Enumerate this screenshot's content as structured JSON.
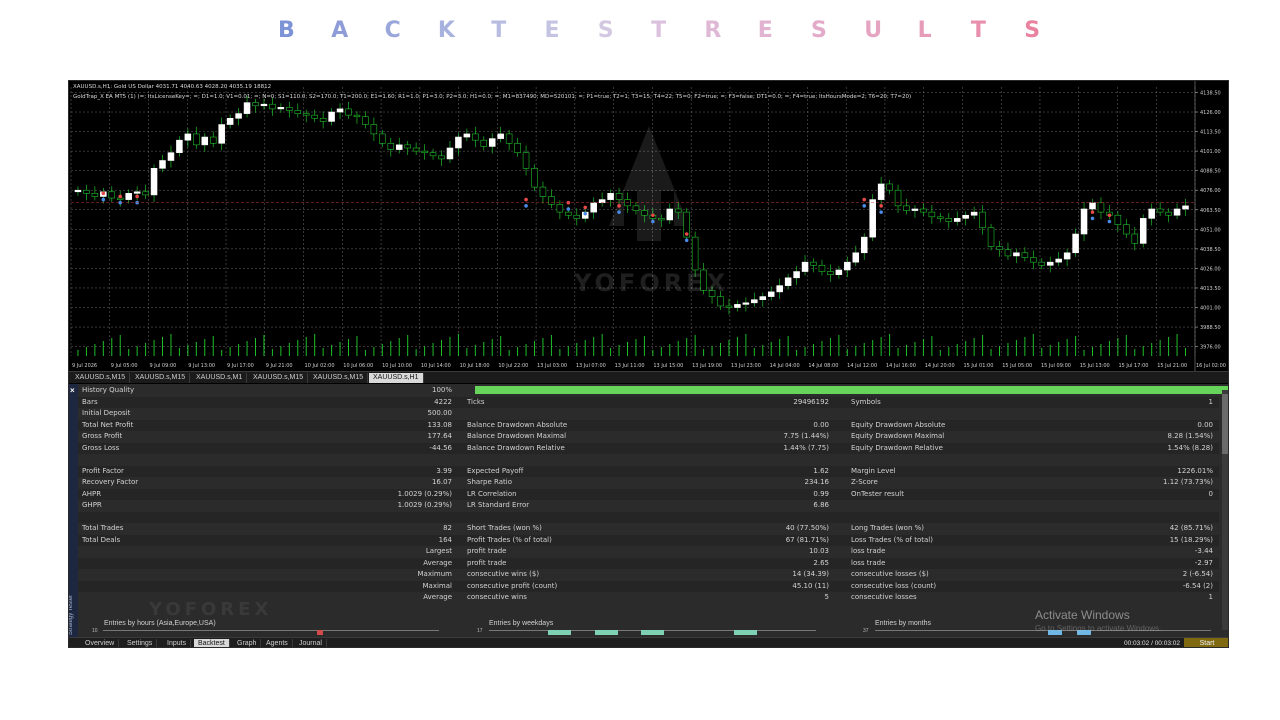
{
  "banner": {
    "letters": [
      "B",
      "A",
      "C",
      "K",
      "T",
      "E",
      "S",
      "T",
      "R",
      "E",
      "S",
      "U",
      "L",
      "T",
      "S"
    ],
    "colors": [
      "#7c93d6",
      "#8e9cd8",
      "#9aa7db",
      "#a8b2de",
      "#b7bce0",
      "#c4c3e2",
      "#d3c8e2",
      "#dbc1dd",
      "#dfb8d6",
      "#e2b2d1",
      "#e3aac9",
      "#e5a4c2",
      "#e69bb9",
      "#e88fae",
      "#e8829f"
    ]
  },
  "chart": {
    "header_line1": "XAUUSD.s,H1:  Gold US Dollar  4031.71 4040.63 4028.20 4035.19  18812",
    "header_line2": "GoldTrap_X EA MT5 (1) (=; ItsLicenseKey=; =; D1=1.0; V1=0.01; =; N=0; S1=110.0; S2=170.0; T1=200.0; E1=1.60; R1=1.0; P1=3.0; P2=3.0; H1=0.0; =; M1=837490; MD=520101; =; P1=true; T2=1; T3=15; T4=22; T5=0; F2=true; =; F3=false; DT1=0.0; =; F4=true; ItsHoursMode=2; T6=20; T7=20)",
    "price_labels": [
      "4138.50",
      "4126.00",
      "4113.50",
      "4101.00",
      "4088.50",
      "4076.00",
      "4063.50",
      "4051.00",
      "4038.50",
      "4026.00",
      "4013.50",
      "4001.00",
      "3988.50",
      "3976.00"
    ],
    "time_labels": [
      "9 Jul 2026",
      "9 Jul 05:00",
      "9 Jul 09:00",
      "9 Jul 13:00",
      "9 Jul 17:00",
      "9 Jul 21:00",
      "10 Jul 02:00",
      "10 Jul 06:00",
      "10 Jul 10:00",
      "10 Jul 14:00",
      "10 Jul 18:00",
      "10 Jul 22:00",
      "13 Jul 03:00",
      "13 Jul 07:00",
      "13 Jul 11:00",
      "13 Jul 15:00",
      "13 Jul 19:00",
      "13 Jul 23:00",
      "14 Jul 04:00",
      "14 Jul 08:00",
      "14 Jul 12:00",
      "14 Jul 16:00",
      "14 Jul 20:00",
      "15 Jul 01:00",
      "15 Jul 05:00",
      "15 Jul 09:00",
      "15 Jul 13:00",
      "15 Jul 17:00",
      "15 Jul 21:00",
      "16 Jul 02:00"
    ],
    "watermark": "YOFOREX",
    "price_range": [
      3970,
      4142
    ],
    "closes": [
      4076,
      4074,
      4072,
      4075,
      4071,
      4070,
      4074,
      4075,
      4073,
      4090,
      4095,
      4100,
      4108,
      4112,
      4105,
      4110,
      4106,
      4118,
      4122,
      4125,
      4132,
      4130,
      4131,
      4128,
      4129,
      4127,
      4125,
      4124,
      4122,
      4120,
      4126,
      4128,
      4124,
      4123,
      4118,
      4112,
      4106,
      4102,
      4105,
      4103,
      4101,
      4100,
      4098,
      4096,
      4103,
      4110,
      4112,
      4108,
      4104,
      4109,
      4112,
      4106,
      4100,
      4090,
      4078,
      4072,
      4067,
      4062,
      4060,
      4058,
      4062,
      4068,
      4070,
      4074,
      4070,
      4066,
      4063,
      4060,
      4058,
      4057,
      4064,
      4062,
      4046,
      4025,
      4012,
      4008,
      4002,
      4001,
      4003,
      4004,
      4006,
      4008,
      4011,
      4015,
      4020,
      4024,
      4030,
      4028,
      4024,
      4022,
      4025,
      4030,
      4036,
      4046,
      4070,
      4080,
      4076,
      4066,
      4063,
      4064,
      4062,
      4059,
      4058,
      4056,
      4058,
      4060,
      4062,
      4052,
      4040,
      4038,
      4034,
      4036,
      4033,
      4030,
      4028,
      4030,
      4032,
      4036,
      4048,
      4064,
      4068,
      4062,
      4060,
      4054,
      4048,
      4042,
      4058,
      4064,
      4062,
      4060,
      4064,
      4066
    ]
  },
  "symbol_tabs": [
    "XAUUSD.s,M15",
    "XAUUSD.s,M15",
    "XAUUSD.s,M1",
    "XAUUSD.s,M15",
    "XAUUSD.s,M15",
    "XAUUSD.s,H1"
  ],
  "tester": {
    "sidebar_x": "×",
    "sidebar_title": "Strategy Tester",
    "rows": [
      {
        "c1l": "History Quality",
        "c1v": "100%",
        "c2l": "",
        "c2v": "",
        "c3l": "",
        "c3v": "",
        "bar": true
      },
      {
        "c1l": "Bars",
        "c1v": "4222",
        "c2l": "Ticks",
        "c2v": "29496192",
        "c3l": "Symbols",
        "c3v": "1"
      },
      {
        "c1l": "Initial Deposit",
        "c1v": "500.00",
        "c2l": "",
        "c2v": "",
        "c3l": "",
        "c3v": ""
      },
      {
        "c1l": "Total Net Profit",
        "c1v": "133.08",
        "c2l": "Balance Drawdown Absolute",
        "c2v": "0.00",
        "c3l": "Equity Drawdown Absolute",
        "c3v": "0.00"
      },
      {
        "c1l": "Gross Profit",
        "c1v": "177.64",
        "c2l": "Balance Drawdown Maximal",
        "c2v": "7.75 (1.44%)",
        "c3l": "Equity Drawdown Maximal",
        "c3v": "8.28 (1.54%)"
      },
      {
        "c1l": "Gross Loss",
        "c1v": "-44.56",
        "c2l": "Balance Drawdown Relative",
        "c2v": "1.44% (7.75)",
        "c3l": "Equity Drawdown Relative",
        "c3v": "1.54% (8.28)"
      },
      {
        "c1l": "",
        "c1v": "",
        "c2l": "",
        "c2v": "",
        "c3l": "",
        "c3v": ""
      },
      {
        "c1l": "Profit Factor",
        "c1v": "3.99",
        "c2l": "Expected Payoff",
        "c2v": "1.62",
        "c3l": "Margin Level",
        "c3v": "1226.01%"
      },
      {
        "c1l": "Recovery Factor",
        "c1v": "16.07",
        "c2l": "Sharpe Ratio",
        "c2v": "234.16",
        "c3l": "Z-Score",
        "c3v": "1.12 (73.73%)"
      },
      {
        "c1l": "AHPR",
        "c1v": "1.0029 (0.29%)",
        "c2l": "LR Correlation",
        "c2v": "0.99",
        "c3l": "OnTester result",
        "c3v": "0"
      },
      {
        "c1l": "GHPR",
        "c1v": "1.0029 (0.29%)",
        "c2l": "LR Standard Error",
        "c2v": "6.86",
        "c3l": "",
        "c3v": ""
      },
      {
        "c1l": "",
        "c1v": "",
        "c2l": "",
        "c2v": "",
        "c3l": "",
        "c3v": ""
      },
      {
        "c1l": "Total Trades",
        "c1v": "82",
        "c2l": "Short Trades (won %)",
        "c2v": "40 (77.50%)",
        "c3l": "Long Trades (won %)",
        "c3v": "42 (85.71%)"
      },
      {
        "c1l": "Total Deals",
        "c1v": "164",
        "c2l": "Profit Trades (% of total)",
        "c2v": "67 (81.71%)",
        "c3l": "Loss Trades (% of total)",
        "c3v": "15 (18.29%)"
      },
      {
        "c1l": "",
        "c1v": "Largest",
        "c2l": "profit trade",
        "c2v": "10.03",
        "c3l": "loss trade",
        "c3v": "-3.44"
      },
      {
        "c1l": "",
        "c1v": "Average",
        "c2l": "profit trade",
        "c2v": "2.65",
        "c3l": "loss trade",
        "c3v": "-2.97"
      },
      {
        "c1l": "",
        "c1v": "Maximum",
        "c2l": "consecutive wins ($)",
        "c2v": "14 (34.39)",
        "c3l": "consecutive losses ($)",
        "c3v": "2 (-6.54)"
      },
      {
        "c1l": "",
        "c1v": "Maximal",
        "c2l": "consecutive profit (count)",
        "c2v": "45.10 (11)",
        "c3l": "consecutive loss (count)",
        "c3v": "-6.54 (2)"
      },
      {
        "c1l": "",
        "c1v": "Average",
        "c2l": "consecutive wins",
        "c2v": "5",
        "c3l": "consecutive losses",
        "c3v": "1"
      }
    ],
    "dist": {
      "hours_title": "Entries by hours (Asia,Europe,USA)",
      "hours_num": "10",
      "weekdays_title": "Entries by weekdays",
      "weekdays_num": "17",
      "months_title": "Entries by months",
      "months_num": "37"
    },
    "activate_title": "Activate Windows",
    "activate_sub": "Go to Settings to activate Windows.",
    "bottom_tabs": [
      "Overview",
      "Settings",
      "Inputs",
      "Backtest",
      "Graph",
      "Agents",
      "Journal"
    ],
    "active_bottom_tab": "Backtest",
    "timer": "00:03:02 / 00:03:02",
    "start_label": "Start"
  },
  "colors": {
    "bull": "#ffffff",
    "bear": "#1fbf2a",
    "grid": "#6e6e6e",
    "quality_bar": "#66d45a",
    "start_button": "#7f6a12"
  }
}
